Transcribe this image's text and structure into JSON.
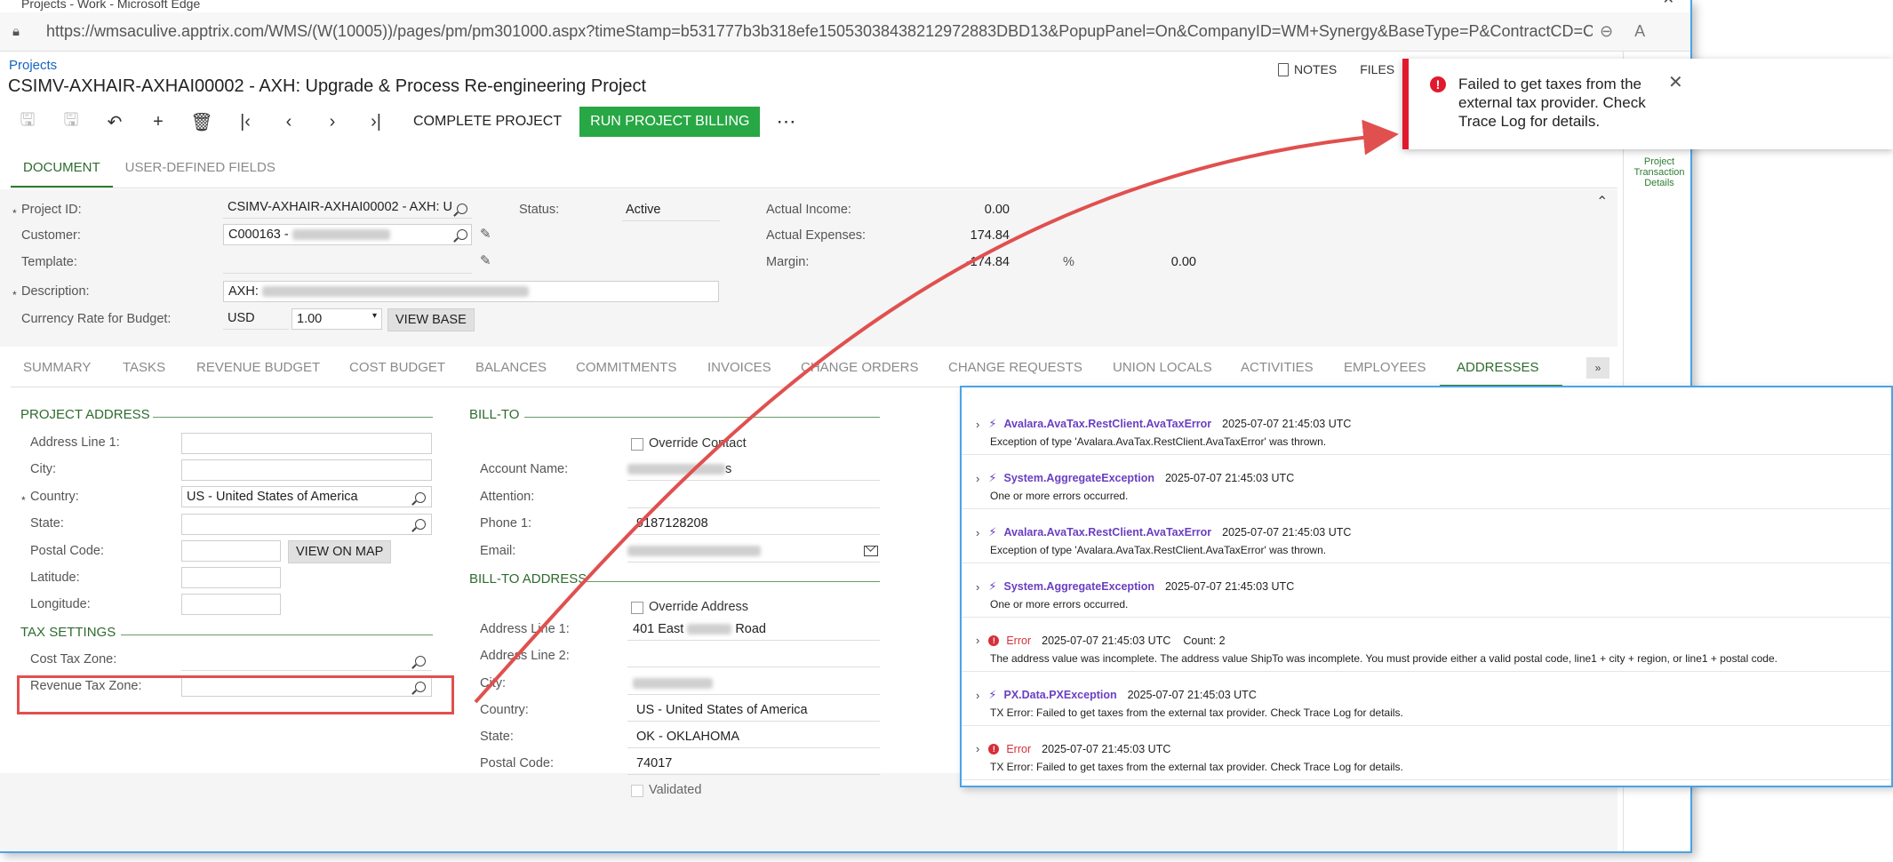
{
  "browser": {
    "title": "Projects - Work - Microsoft Edge",
    "url": "https://wmsaculive.apptrix.com/WMS/(W(10005))/pages/pm/pm301000.aspx?timeStamp=b531777b3b318efe15053038438212972883DBD13&PopupPanel=On&CompanyID=WM+Synergy&BaseType=P&ContractCD=CSIMV-..."
  },
  "header": {
    "breadcrumb": "Projects",
    "title": "CSIMV-AXHAIR-AXHAI00002 - AXH: Upgrade & Process Re-engineering Project",
    "notes_label": "NOTES",
    "files_label": "FILES"
  },
  "toolbar": {
    "complete_label": "COMPLETE PROJECT",
    "billing_label": "RUN PROJECT BILLING",
    "more_label": "⋯"
  },
  "doc_tabs": [
    "DOCUMENT",
    "USER-DEFINED FIELDS"
  ],
  "summary": {
    "project_id_label": "Project ID:",
    "project_id_value": "CSIMV-AXHAIR-AXHAI00002 - AXH: U",
    "customer_label": "Customer:",
    "customer_value": "C000163 -",
    "template_label": "Template:",
    "description_label": "Description:",
    "description_value": "AXH:",
    "currency_label": "Currency Rate for Budget:",
    "currency_value": "USD",
    "rate_value": "1.00",
    "view_base_label": "VIEW BASE",
    "status_label": "Status:",
    "status_value": "Active",
    "actual_income_label": "Actual Income:",
    "actual_income_value": "0.00",
    "actual_expenses_label": "Actual Expenses:",
    "actual_expenses_value": "174.84",
    "margin_label": "Margin:",
    "margin_value": "-174.84",
    "percent_label": "%",
    "percent_value": "0.00"
  },
  "right_panel": {
    "link_label": "Project Transaction Details"
  },
  "section_tabs": [
    "SUMMARY",
    "TASKS",
    "REVENUE BUDGET",
    "COST BUDGET",
    "BALANCES",
    "COMMITMENTS",
    "INVOICES",
    "CHANGE ORDERS",
    "CHANGE REQUESTS",
    "UNION LOCALS",
    "ACTIVITIES",
    "EMPLOYEES",
    "ADDRESSES"
  ],
  "project_address": {
    "heading": "PROJECT ADDRESS",
    "address1_label": "Address Line 1:",
    "city_label": "City:",
    "country_label": "Country:",
    "country_value": "US - United States of America",
    "state_label": "State:",
    "postal_label": "Postal Code:",
    "view_map_label": "VIEW ON MAP",
    "latitude_label": "Latitude:",
    "longitude_label": "Longitude:"
  },
  "tax_settings": {
    "heading": "TAX SETTINGS",
    "cost_tax_label": "Cost Tax Zone:",
    "revenue_tax_label": "Revenue Tax Zone:"
  },
  "bill_to": {
    "heading": "BILL-TO",
    "override_contact_label": "Override Contact",
    "account_name_label": "Account Name:",
    "account_name_suffix": "s",
    "attention_label": "Attention:",
    "phone_label": "Phone 1:",
    "phone_value": "9187128208",
    "email_label": "Email:"
  },
  "bill_to_address": {
    "heading": "BILL-TO ADDRESS",
    "override_address_label": "Override Address",
    "address1_label": "Address Line 1:",
    "address1_value": "401 East",
    "address1_suffix": "Road",
    "address2_label": "Address Line 2:",
    "city_label": "City:",
    "country_label": "Country:",
    "country_value": "US - United States of America",
    "state_label": "State:",
    "state_value": "OK - OKLAHOMA",
    "postal_label": "Postal Code:",
    "postal_value": "74017",
    "validated_label": "Validated"
  },
  "toast": {
    "message": "Failed to get taxes from the external tax provider. Check Trace Log for details."
  },
  "trace_log": [
    {
      "kind": "exception",
      "type": "Avalara.AvaTax.RestClient.AvaTaxError",
      "time": "2025-07-07 21:45:03 UTC",
      "count": "",
      "message": "Exception of type 'Avalara.AvaTax.RestClient.AvaTaxError' was thrown."
    },
    {
      "kind": "exception",
      "type": "System.AggregateException",
      "time": "2025-07-07 21:45:03 UTC",
      "count": "",
      "message": "One or more errors occurred."
    },
    {
      "kind": "exception",
      "type": "Avalara.AvaTax.RestClient.AvaTaxError",
      "time": "2025-07-07 21:45:03 UTC",
      "count": "",
      "message": "Exception of type 'Avalara.AvaTax.RestClient.AvaTaxError' was thrown."
    },
    {
      "kind": "exception",
      "type": "System.AggregateException",
      "time": "2025-07-07 21:45:03 UTC",
      "count": "",
      "message": "One or more errors occurred."
    },
    {
      "kind": "error",
      "type": "Error",
      "time": "2025-07-07 21:45:03 UTC",
      "count": "Count: 2",
      "message": "The address value was incomplete. The address value ShipTo was incomplete. You must provide either a valid postal code, line1 + city + region, or line1 + postal code."
    },
    {
      "kind": "exception",
      "type": "PX.Data.PXException",
      "time": "2025-07-07 21:45:03 UTC",
      "count": "",
      "message": "TX Error: Failed to get taxes from the external tax provider. Check Trace Log for details."
    },
    {
      "kind": "error",
      "type": "Error",
      "time": "2025-07-07 21:45:03 UTC",
      "count": "",
      "message": "TX Error: Failed to get taxes from the external tax provider. Check Trace Log for details."
    }
  ],
  "colors": {
    "accent_green": "#28a745",
    "tab_green": "#2e7d32",
    "error_red": "#e1192d",
    "annotation_red": "#e0504f",
    "log_type_purple": "#6a3fc2"
  }
}
